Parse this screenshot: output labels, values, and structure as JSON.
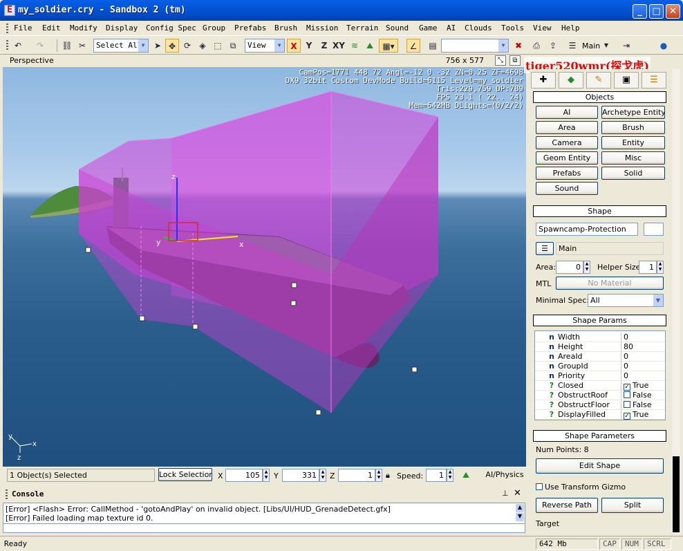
{
  "window": {
    "title": "my_soldier.cry - Sandbox 2 (tm)"
  },
  "menu": [
    "File",
    "Edit",
    "Modify",
    "Display",
    "Config Spec",
    "Group",
    "Prefabs",
    "Brush",
    "Mission",
    "Terrain",
    "Sound",
    "Game",
    "AI",
    "Clouds",
    "Tools",
    "View",
    "Help"
  ],
  "toolbar": {
    "selection_combo": "Select All",
    "coord_combo": "View",
    "axis_x": "X",
    "axis_y": "Y",
    "axis_z": "Z",
    "axis_xy": "XY",
    "layer_label": "Main"
  },
  "viewport": {
    "title": "Perspective",
    "size": "756 x 577",
    "stats": [
      "CamPos=1771 448   72 Angl=-12   0 -32 ZN=0.25 ZF=4698",
      "DX9 32bit Custom DevMode Build=6115 Level=my_soldier",
      "Tris:229,759  DP:789",
      "FPS  23.1 ( 22.. 24)",
      "Mem=642MB DLights=(0/2/2)"
    ],
    "gizmo_labels": {
      "x": "x",
      "y": "y",
      "z": "z"
    }
  },
  "watermark": "tiger520wmr(探戈虎)",
  "panel": {
    "objects_header": "Objects",
    "object_buttons": [
      "AI",
      "Archetype Entity",
      "Area",
      "Brush",
      "Camera",
      "Entity",
      "Geom Entity",
      "Misc",
      "Prefabs",
      "Solid",
      "Sound"
    ],
    "shape_header": "Shape",
    "shape_name": "Spawncamp-Protection",
    "layer": "Main",
    "area_label": "Area:",
    "area_value": "0",
    "helper_size_label": "Helper Size:",
    "helper_size_value": "1",
    "mtl_label": "MTL",
    "mtl_button": "No Material",
    "minimal_spec_label": "Minimal Spec:",
    "minimal_spec_value": "All",
    "shape_params_header": "Shape Params",
    "params": [
      {
        "type": "n",
        "name": "Width",
        "value": "0"
      },
      {
        "type": "n",
        "name": "Height",
        "value": "80"
      },
      {
        "type": "n",
        "name": "AreaId",
        "value": "0"
      },
      {
        "type": "n",
        "name": "GroupId",
        "value": "0"
      },
      {
        "type": "n",
        "name": "Priority",
        "value": "0"
      },
      {
        "type": "?",
        "name": "Closed",
        "value": "True",
        "checked": true
      },
      {
        "type": "?",
        "name": "ObstructRoof",
        "value": "False",
        "checked": false
      },
      {
        "type": "?",
        "name": "ObstructFloor",
        "value": "False",
        "checked": false
      },
      {
        "type": "?",
        "name": "DisplayFilled",
        "value": "True",
        "checked": true
      }
    ],
    "shape_parameters_header": "Shape Parameters",
    "num_points": "Num Points: 8",
    "edit_shape": "Edit Shape",
    "use_transform_gizmo": "Use Transform Gizmo",
    "reverse_path": "Reverse Path",
    "split": "Split",
    "target_label": "Target"
  },
  "coordbar": {
    "selected": "1 Object(s) Selected",
    "lock_selection": "Lock Selection",
    "x_label": "X",
    "x": "105",
    "y_label": "Y",
    "y": "331",
    "z_label": "Z",
    "z": "1",
    "speed_label": "Speed:",
    "speed": "1",
    "ai_physics": "AI/Physics"
  },
  "console": {
    "title": "Console",
    "lines": [
      "[Error] <Flash> Error: CallMethod - 'gotoAndPlay' on invalid object. [Libs/UI/HUD_GrenadeDetect.gfx]",
      "[Error] Failed loading map texture id 0."
    ]
  },
  "status": {
    "ready": "Ready",
    "memory": "642 Mb",
    "cap": "CAP",
    "num": "NUM",
    "scrl": "SCRL"
  },
  "colors": {
    "titlebar": "#0355d6",
    "shape_fill": "#c83cc8",
    "sea": "#2a5d8c",
    "sky": "#a9cbea"
  }
}
